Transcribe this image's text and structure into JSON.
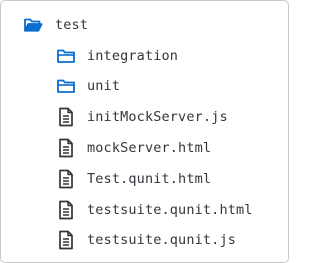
{
  "tree": {
    "root": {
      "label": "test",
      "icon": "open-folder-icon"
    },
    "items": [
      {
        "label": "integration",
        "icon": "folder-icon"
      },
      {
        "label": "unit",
        "icon": "folder-icon"
      },
      {
        "label": "initMockServer.js",
        "icon": "document-icon"
      },
      {
        "label": "mockServer.html",
        "icon": "document-icon"
      },
      {
        "label": "Test.qunit.html",
        "icon": "document-icon"
      },
      {
        "label": "testsuite.qunit.html",
        "icon": "document-icon"
      },
      {
        "label": "testsuite.qunit.js",
        "icon": "document-icon"
      }
    ]
  },
  "colors": {
    "folder_icon": "#0a6ed1",
    "document_icon": "#32363a",
    "text": "#32363a",
    "border": "#c8c8c8"
  }
}
